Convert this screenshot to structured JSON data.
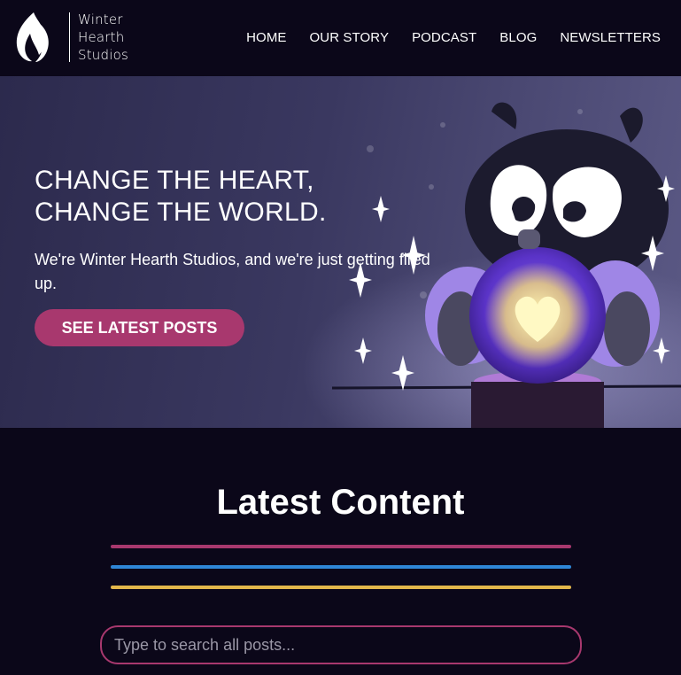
{
  "header": {
    "logo_lines": [
      "Winter",
      "Hearth",
      "Studios"
    ],
    "nav": [
      "HOME",
      "OUR STORY",
      "PODCAST",
      "BLOG",
      "NEWSLETTERS"
    ]
  },
  "hero": {
    "title_lines": [
      "CHANGE THE HEART,",
      "CHANGE THE WORLD."
    ],
    "subtitle": "We're Winter Hearth Studios, and we're just getting fired up.",
    "button_label": "SEE LATEST POSTS"
  },
  "latest": {
    "title": "Latest Content",
    "divider_colors": [
      "#a8386e",
      "#2f86d6",
      "#e3b74b"
    ]
  },
  "search": {
    "placeholder": "Type to search all posts..."
  },
  "colors": {
    "background": "#0b0719",
    "accent": "#a8386e",
    "blue": "#2f86d6",
    "yellow": "#e3b74b"
  }
}
